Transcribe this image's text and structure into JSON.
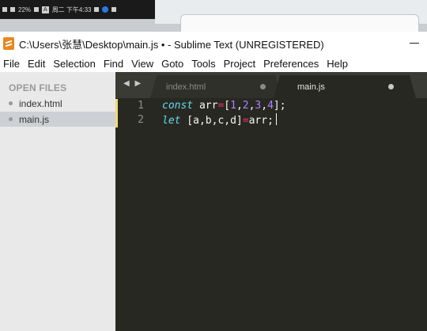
{
  "os_bar": {
    "battery": "22%",
    "ab": "A",
    "time": "周二 下午4:33"
  },
  "window": {
    "title": "C:\\Users\\张慧\\Desktop\\main.js • - Sublime Text (UNREGISTERED)"
  },
  "menu": [
    "File",
    "Edit",
    "Selection",
    "Find",
    "View",
    "Goto",
    "Tools",
    "Project",
    "Preferences",
    "Help"
  ],
  "sidebar": {
    "header": "OPEN FILES",
    "files": [
      {
        "name": "index.html",
        "active": false
      },
      {
        "name": "main.js",
        "active": true
      }
    ]
  },
  "tabs": [
    {
      "label": "index.html",
      "active": false
    },
    {
      "label": "main.js",
      "active": true
    }
  ],
  "nav_arrows": "◀ ▶",
  "editor": {
    "lines": [
      {
        "number": "1",
        "tokens": [
          {
            "t": "const",
            "c": "kw"
          },
          {
            "t": " arr",
            "c": "pl"
          },
          {
            "t": "=",
            "c": "op"
          },
          {
            "t": "[",
            "c": "pl"
          },
          {
            "t": "1",
            "c": "num"
          },
          {
            "t": ",",
            "c": "pl"
          },
          {
            "t": "2",
            "c": "num"
          },
          {
            "t": ",",
            "c": "pl"
          },
          {
            "t": "3",
            "c": "num"
          },
          {
            "t": ",",
            "c": "pl"
          },
          {
            "t": "4",
            "c": "num"
          },
          {
            "t": "];",
            "c": "pl"
          }
        ]
      },
      {
        "number": "2",
        "tokens": [
          {
            "t": "let",
            "c": "kw"
          },
          {
            "t": " [a,b,c,d]",
            "c": "pl"
          },
          {
            "t": "=",
            "c": "op"
          },
          {
            "t": "arr;",
            "c": "pl"
          }
        ]
      }
    ]
  },
  "colors": {
    "keyword": "#66d9ef",
    "operator": "#f92672",
    "number": "#ae81ff",
    "editor_bg": "#272822",
    "gutter_mark": "#f0d97a"
  }
}
